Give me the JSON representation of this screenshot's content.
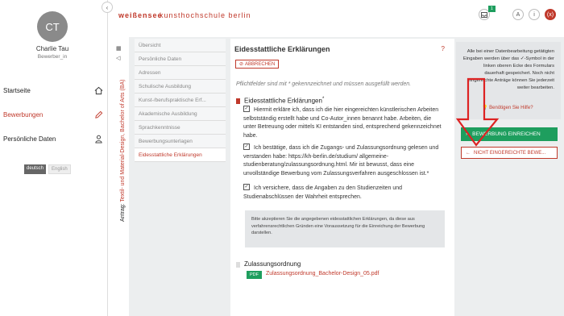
{
  "user": {
    "initials": "CT",
    "name": "Charlie Tau",
    "role": "Bewerber_in"
  },
  "nav": [
    {
      "label": "Startseite",
      "icon": "home-icon"
    },
    {
      "label": "Bewerbungen",
      "icon": "pencil-icon"
    },
    {
      "label": "Persönliche Daten",
      "icon": "person-icon"
    }
  ],
  "lang": {
    "de": "deutsch",
    "en": "English"
  },
  "header": {
    "logo": "weißensee",
    "school": "kunsthochschule berlin",
    "badge": "1",
    "icon_a": "A",
    "icon_i": "i",
    "icon_x": "(x)"
  },
  "vertical": {
    "prefix": "Antrag: ",
    "program": "Textil- und Material-Design, Bachelor of Arts (BA)"
  },
  "subnav": [
    "Übersicht",
    "Persönliche Daten",
    "Adressen",
    "Schulische Ausbildung",
    "Kunst-/berufspraktische Erf...",
    "Akademische Ausbildung",
    "Sprachkenntnisse",
    "Bewerbungsunterlagen",
    "Eidesstattliche Erklärungen"
  ],
  "main": {
    "title": "Eidesstattliche Erklärungen",
    "help": "?",
    "abbrechen": "ABBRECHEN",
    "hint": "Pflichtfelder sind mit * gekennzeichnet und müssen ausgefüllt werden.",
    "section_title": "Eidesstattliche Erklärungen",
    "star": "*",
    "p1": "Hiermit erkläre ich, dass ich die hier eingereichten künstlerischen Arbeiten selbstständig erstellt habe und Co-Autor_innen benannt habe. Arbeiten, die unter Betreuung oder mittels KI entstanden sind, entsprechend gekennzeichnet habe.",
    "p2": "Ich bestätige, dass ich die Zugangs- und Zulassungsordnung gelesen und verstanden habe: https://kh-berlin.de/studium/ allgemeine-studienberatung/zulassungsordnung.html. Mir ist bewusst, dass eine unvollständige Bewerbung vom Zulassungsverfahren ausgeschlossen ist.*",
    "p3": "Ich versichere, dass die Angaben zu den Studienzeiten und Studienabschlüssen der Wahrheit entsprechen.",
    "info": "Bitte akzeptieren Sie die angegebenen eidesstattlichen Erklärungen, da diese aus verfahrensrechtlichen Gründen eine Voraussetzung für die Einreichung der Bewerbung darstellen.",
    "zul_title": "Zulassungsordnung",
    "pdf_tag": "PDF",
    "pdf_link": "Zulassungsordnung_Bachelor-Design_05.pdf"
  },
  "right": {
    "info": "Alle bei einer Datenbearbeitung getätigten Eingaben werden über das ✓-Symbol in der linken oberen Ecke des Formulars dauerhaft gespeichert. Noch nicht eingereichte Anträge können Sie jederzeit weiter bearbeiten.",
    "help": "Benötigen Sie Hilfe?",
    "submit": "BEWERBUNG EINREICHEN",
    "other": "NICHT EINGEREICHTE BEWE..."
  },
  "colors": {
    "accent": "#c0392b",
    "green": "#1e9e5e"
  }
}
